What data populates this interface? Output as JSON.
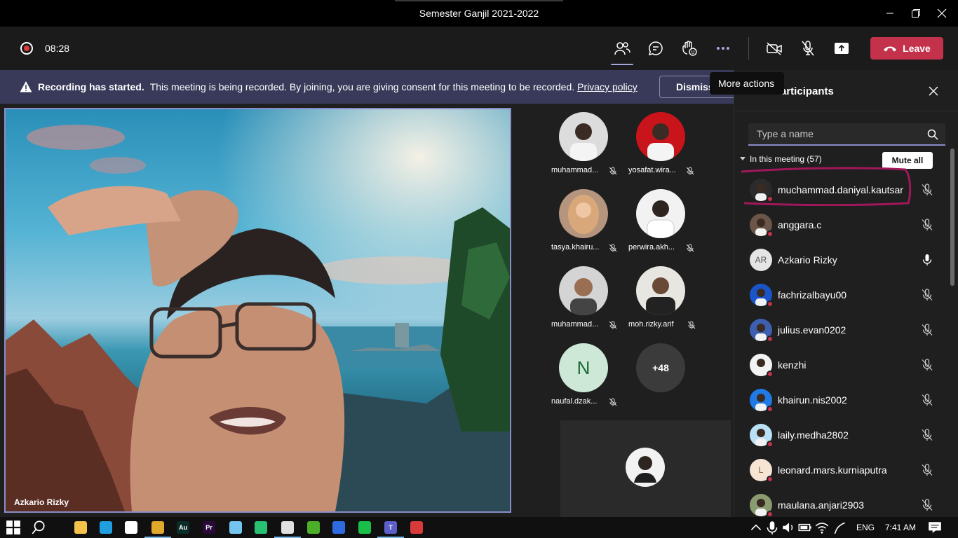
{
  "window": {
    "title": "Semester Ganjil 2021-2022"
  },
  "toolbar": {
    "timer": "08:28",
    "leave_label": "Leave",
    "tooltip": "More actions"
  },
  "banner": {
    "bold": "Recording has started.",
    "message": "This meeting is being recorded. By joining, you are giving consent for this meeting to be recorded.",
    "link": "Privacy policy",
    "dismiss_label": "Dismiss"
  },
  "main_video": {
    "name": "Azkario Rizky"
  },
  "tiles": [
    {
      "name": "muhammad...",
      "color": "#d9d9d9"
    },
    {
      "name": "yosafat.wira...",
      "color": "#c8141a"
    },
    {
      "name": "tasya.khairu...",
      "color": "#e8b79a"
    },
    {
      "name": "perwira.akh...",
      "color": "#eeeeee"
    },
    {
      "name": "muhammad...",
      "color": "#cfcfcf"
    },
    {
      "name": "moh.rizky.arif",
      "color": "#e6e6e6"
    },
    {
      "name": "naufal.dzak...",
      "initial": "N",
      "color": "#cde8d6"
    },
    {
      "overflow": "+48"
    }
  ],
  "panel": {
    "title": "Participants",
    "search_placeholder": "Type a name",
    "section": "In this meeting (57)",
    "mute_all": "Mute all",
    "participants": [
      {
        "name": "muchammad.daniyal.kautsar",
        "mic": "muted"
      },
      {
        "name": "anggara.c",
        "mic": "muted"
      },
      {
        "name": "Azkario Rizky",
        "initials": "AR",
        "mic": "on"
      },
      {
        "name": "fachrizalbayu00",
        "mic": "muted"
      },
      {
        "name": "julius.evan0202",
        "mic": "muted"
      },
      {
        "name": "kenzhi",
        "mic": "muted"
      },
      {
        "name": "khairun.nis2002",
        "mic": "muted"
      },
      {
        "name": "laily.medha2802",
        "mic": "muted"
      },
      {
        "name": "leonard.mars.kurniaputra",
        "initials": "L",
        "mic": "muted"
      },
      {
        "name": "maulana.anjari2903",
        "mic": "muted"
      }
    ]
  },
  "taskbar": {
    "lang": "ENG",
    "time": "7:41 AM",
    "apps": [
      "file-explorer",
      "edge",
      "store",
      "chrome",
      "audition",
      "premiere",
      "notepad",
      "media-player",
      "app-1",
      "utorrent",
      "meet",
      "line",
      "teams",
      "paint"
    ]
  },
  "colors": {
    "accent": "#8b8cc7",
    "leave": "#c4314b",
    "banner": "#393a5a",
    "highlight": "#a0185a"
  }
}
